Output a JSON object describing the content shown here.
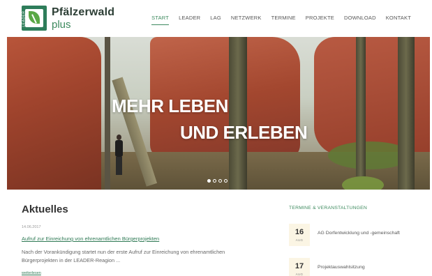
{
  "header": {
    "logo": {
      "title": "Pfälzerwald",
      "subtitle": "plus",
      "mark_text": "LEADER"
    },
    "nav": [
      {
        "label": "START",
        "active": true
      },
      {
        "label": "LEADER",
        "active": false
      },
      {
        "label": "LAG",
        "active": false
      },
      {
        "label": "NETZWERK",
        "active": false
      },
      {
        "label": "TERMINE",
        "active": false
      },
      {
        "label": "PROJEKTE",
        "active": false
      },
      {
        "label": "DOWNLOAD",
        "active": false
      },
      {
        "label": "KONTAKT",
        "active": false
      }
    ]
  },
  "hero": {
    "line1": "MEHR LEBEN",
    "line2": "UND ERLEBEN",
    "slides": 4,
    "active_slide": 1
  },
  "news": {
    "heading": "Aktuelles",
    "date": "14.06.2017",
    "title": "Aufruf zur Einreichung von ehrenamtlichen Bürgerprojekten",
    "body": "Nach der Vorankündigung startet nun der erste Aufruf zur Einreichung von ehrenamtlichen Bürgerprojekten in der LEADER-Reagion ...",
    "more": "weiterlesen"
  },
  "events": {
    "heading": "TERMINE & VERANSTALTUNGEN",
    "items": [
      {
        "day": "16",
        "month": "AUG",
        "title": "AG Dorfentwicklung und -gemeinschaft"
      },
      {
        "day": "17",
        "month": "AUG",
        "title": "Projektauswahlsitzung"
      }
    ]
  },
  "colors": {
    "accent": "#3d8a5e",
    "link": "#2f7a55",
    "calendar_bg": "#fbf5e4"
  }
}
